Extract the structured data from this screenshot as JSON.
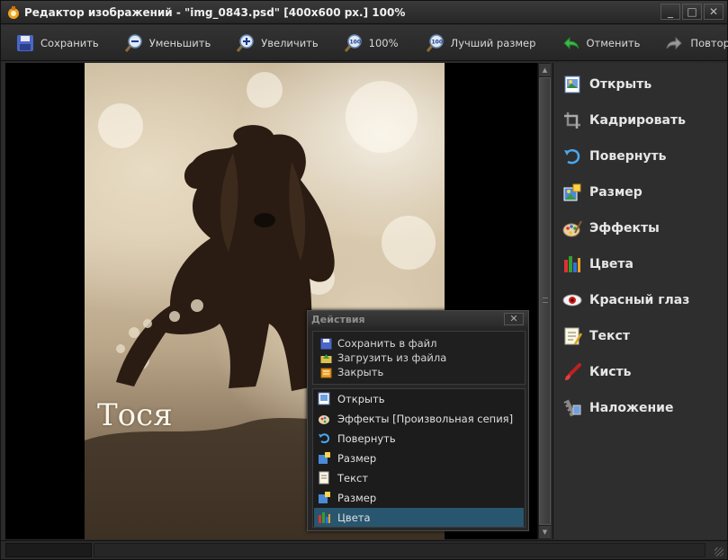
{
  "window": {
    "title": "Редактор изображений - \"img_0843.psd\"  [400x600 px.]  100%",
    "controls": [
      "_",
      "□",
      "✕"
    ]
  },
  "toolbar": {
    "items": [
      {
        "label": "Сохранить",
        "icon": "save-icon"
      },
      {
        "label": "Уменьшить",
        "icon": "zoom-out-icon"
      },
      {
        "label": "Увеличить",
        "icon": "zoom-in-icon"
      },
      {
        "label": "100%",
        "icon": "zoom-100-icon"
      },
      {
        "label": "Лучший размер",
        "icon": "zoom-fit-icon"
      },
      {
        "label": "Отменить",
        "icon": "undo-icon"
      },
      {
        "label": "Повторить",
        "icon": "redo-icon"
      }
    ]
  },
  "image": {
    "caption": "Тося"
  },
  "right_panel": {
    "items": [
      {
        "label": "Открыть",
        "icon": "open-icon"
      },
      {
        "label": "Кадрировать",
        "icon": "crop-icon"
      },
      {
        "label": "Повернуть",
        "icon": "rotate-icon"
      },
      {
        "label": "Размер",
        "icon": "resize-icon"
      },
      {
        "label": "Эффекты",
        "icon": "effects-icon"
      },
      {
        "label": "Цвета",
        "icon": "colors-icon"
      },
      {
        "label": "Красный глаз",
        "icon": "red-eye-icon"
      },
      {
        "label": "Текст",
        "icon": "text-icon"
      },
      {
        "label": "Кисть",
        "icon": "brush-icon"
      },
      {
        "label": "Наложение",
        "icon": "overlay-icon"
      }
    ]
  },
  "actions_panel": {
    "title": "Действия",
    "close": "✕",
    "links": [
      {
        "label": "Сохранить в файл",
        "icon": "save-icon"
      },
      {
        "label": "Загрузить из файла",
        "icon": "load-icon"
      },
      {
        "label": "Закрыть",
        "icon": "close-icon"
      }
    ],
    "history": [
      {
        "label": "Открыть",
        "icon": "open-icon",
        "selected": false
      },
      {
        "label": "Эффекты [Произвольная сепия]",
        "icon": "effects-icon",
        "selected": false
      },
      {
        "label": "Повернуть",
        "icon": "rotate-icon",
        "selected": false
      },
      {
        "label": "Размер",
        "icon": "resize-icon",
        "selected": false
      },
      {
        "label": "Текст",
        "icon": "text-icon",
        "selected": false
      },
      {
        "label": "Размер",
        "icon": "resize-icon",
        "selected": false
      },
      {
        "label": "Цвета",
        "icon": "colors-icon",
        "selected": true
      }
    ]
  },
  "colors": {
    "selection": "#28566f",
    "background": "#2b2b2b"
  }
}
